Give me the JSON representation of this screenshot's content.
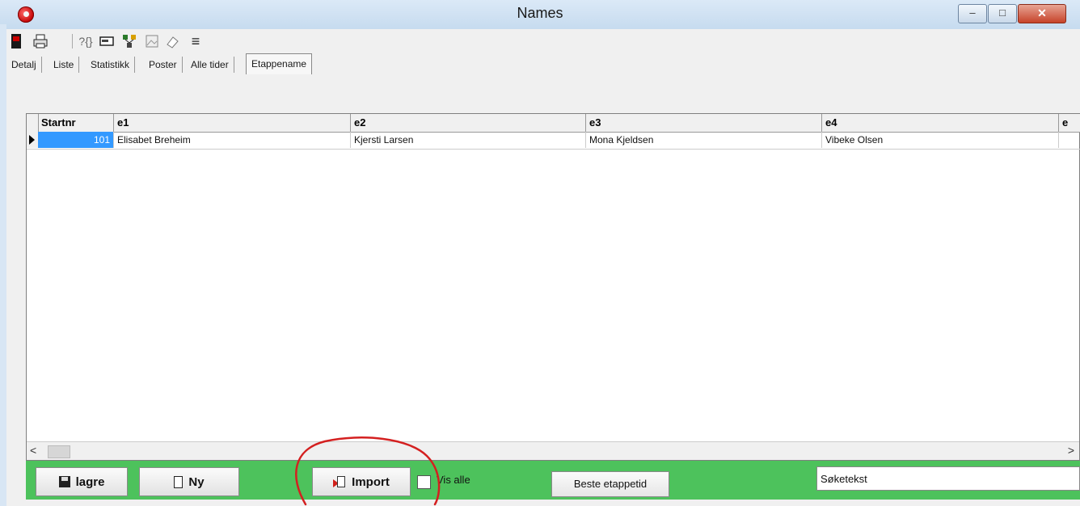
{
  "window": {
    "title": "Names",
    "controls": {
      "minimize": "–",
      "maximize": "□",
      "close": "✕"
    }
  },
  "toolbar": {
    "icons": [
      "exit-icon",
      "print-icon",
      "help-icon",
      "card-icon",
      "network-icon",
      "image-icon",
      "eraser-icon",
      "menu-icon"
    ],
    "help_glyph": "?{}"
  },
  "tabs": [
    {
      "label": "Detalj"
    },
    {
      "label": "Liste"
    },
    {
      "label": "Statistikk"
    },
    {
      "label": "Poster"
    },
    {
      "label": "Alle tider"
    },
    {
      "label": "Etappename",
      "active": true
    }
  ],
  "grid": {
    "columns": [
      "Startnr",
      "e1",
      "e2",
      "e3",
      "e4",
      "e"
    ],
    "rows": [
      {
        "startnr": "101",
        "e1": "Elisabet Breheim",
        "e2": "Kjersti Larsen",
        "e3": "Mona Kjeldsen",
        "e4": "Vibeke Olsen"
      }
    ]
  },
  "bottom": {
    "save_label": "lagre",
    "new_label": "Ny",
    "import_label": "Import",
    "show_all_label": "Vis alle",
    "show_all_checked": false,
    "best_label": "Beste etappetid",
    "search_value": "Søketekst"
  },
  "colors": {
    "bottom_bar": "#4dc25c",
    "selection": "#3399ff",
    "annotation": "#d42020"
  }
}
